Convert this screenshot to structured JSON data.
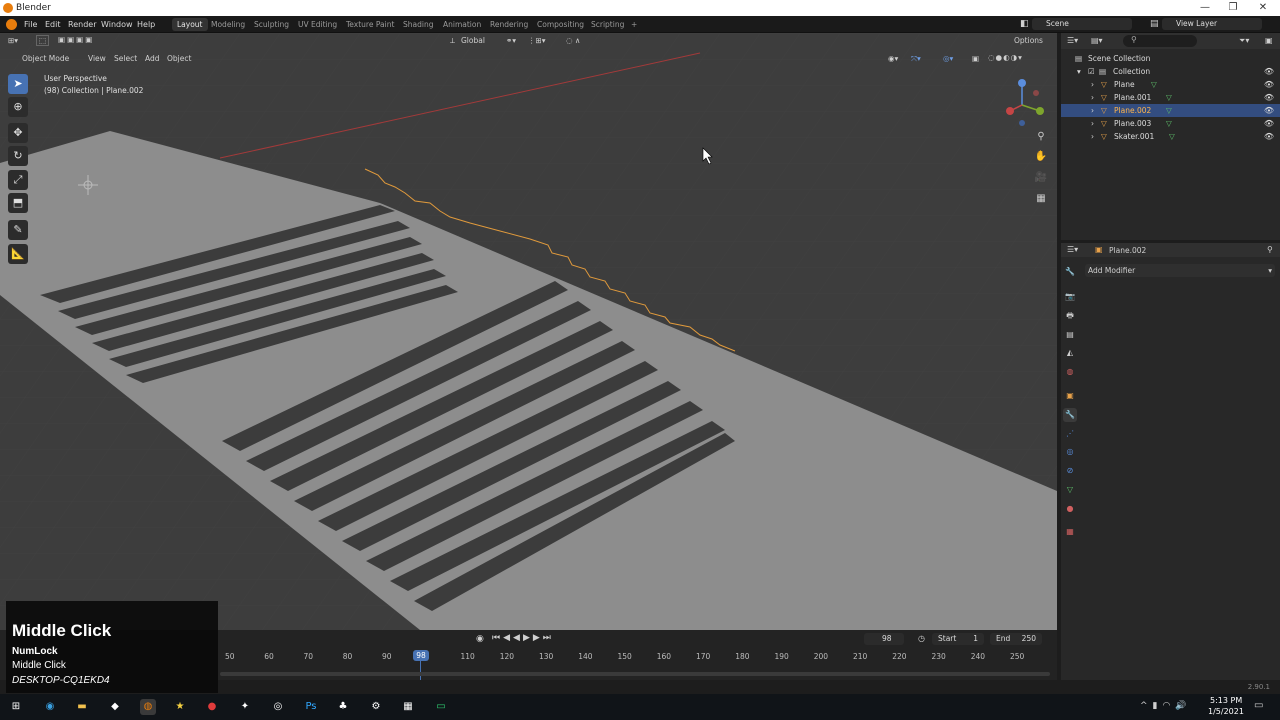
{
  "app": {
    "title": "Blender",
    "version": "2.90.1"
  },
  "menu": [
    "File",
    "Edit",
    "Render",
    "Window",
    "Help"
  ],
  "workspaces": [
    {
      "label": "Layout",
      "active": true
    },
    {
      "label": "Modeling"
    },
    {
      "label": "Sculpting"
    },
    {
      "label": "UV Editing"
    },
    {
      "label": "Texture Paint"
    },
    {
      "label": "Shading"
    },
    {
      "label": "Animation"
    },
    {
      "label": "Rendering"
    },
    {
      "label": "Compositing"
    },
    {
      "label": "Scripting"
    }
  ],
  "scene": {
    "label": "Scene"
  },
  "view_layer": {
    "label": "View Layer"
  },
  "viewport_header": {
    "transform_orientation": "Global",
    "options_label": "Options",
    "mode": "Object Mode",
    "view_menu": [
      "View",
      "Select",
      "Add",
      "Object"
    ]
  },
  "viewport_info": {
    "perspective": "User Perspective",
    "collection": "(98) Collection | Plane.002"
  },
  "outliner": {
    "rows": [
      {
        "label": "Scene Collection",
        "indent": 0,
        "selected": false
      },
      {
        "label": "Collection",
        "indent": 1,
        "selected": false
      },
      {
        "label": "Plane",
        "indent": 2,
        "selected": false
      },
      {
        "label": "Plane.001",
        "indent": 2,
        "selected": false
      },
      {
        "label": "Plane.002",
        "indent": 2,
        "selected": true
      },
      {
        "label": "Plane.003",
        "indent": 2,
        "selected": false
      },
      {
        "label": "Skater.001",
        "indent": 2,
        "selected": false
      }
    ]
  },
  "properties": {
    "object_name": "Plane.002",
    "add_modifier_label": "Add Modifier"
  },
  "timeline": {
    "current_frame": "98",
    "start_label": "Start",
    "start": "1",
    "end_label": "End",
    "end": "250",
    "ticks": [
      "50",
      "60",
      "70",
      "80",
      "90",
      "110",
      "120",
      "130",
      "140",
      "150",
      "160",
      "170",
      "180",
      "190",
      "200",
      "210",
      "220",
      "230",
      "240",
      "250"
    ],
    "playhead": "98"
  },
  "overlay": {
    "title": "Middle Click",
    "line1": "NumLock",
    "line2": "Middle Click",
    "host": "DESKTOP-CQ1EKD4"
  },
  "taskbar": {
    "time": "5:13 PM",
    "date": "1/5/2021"
  }
}
